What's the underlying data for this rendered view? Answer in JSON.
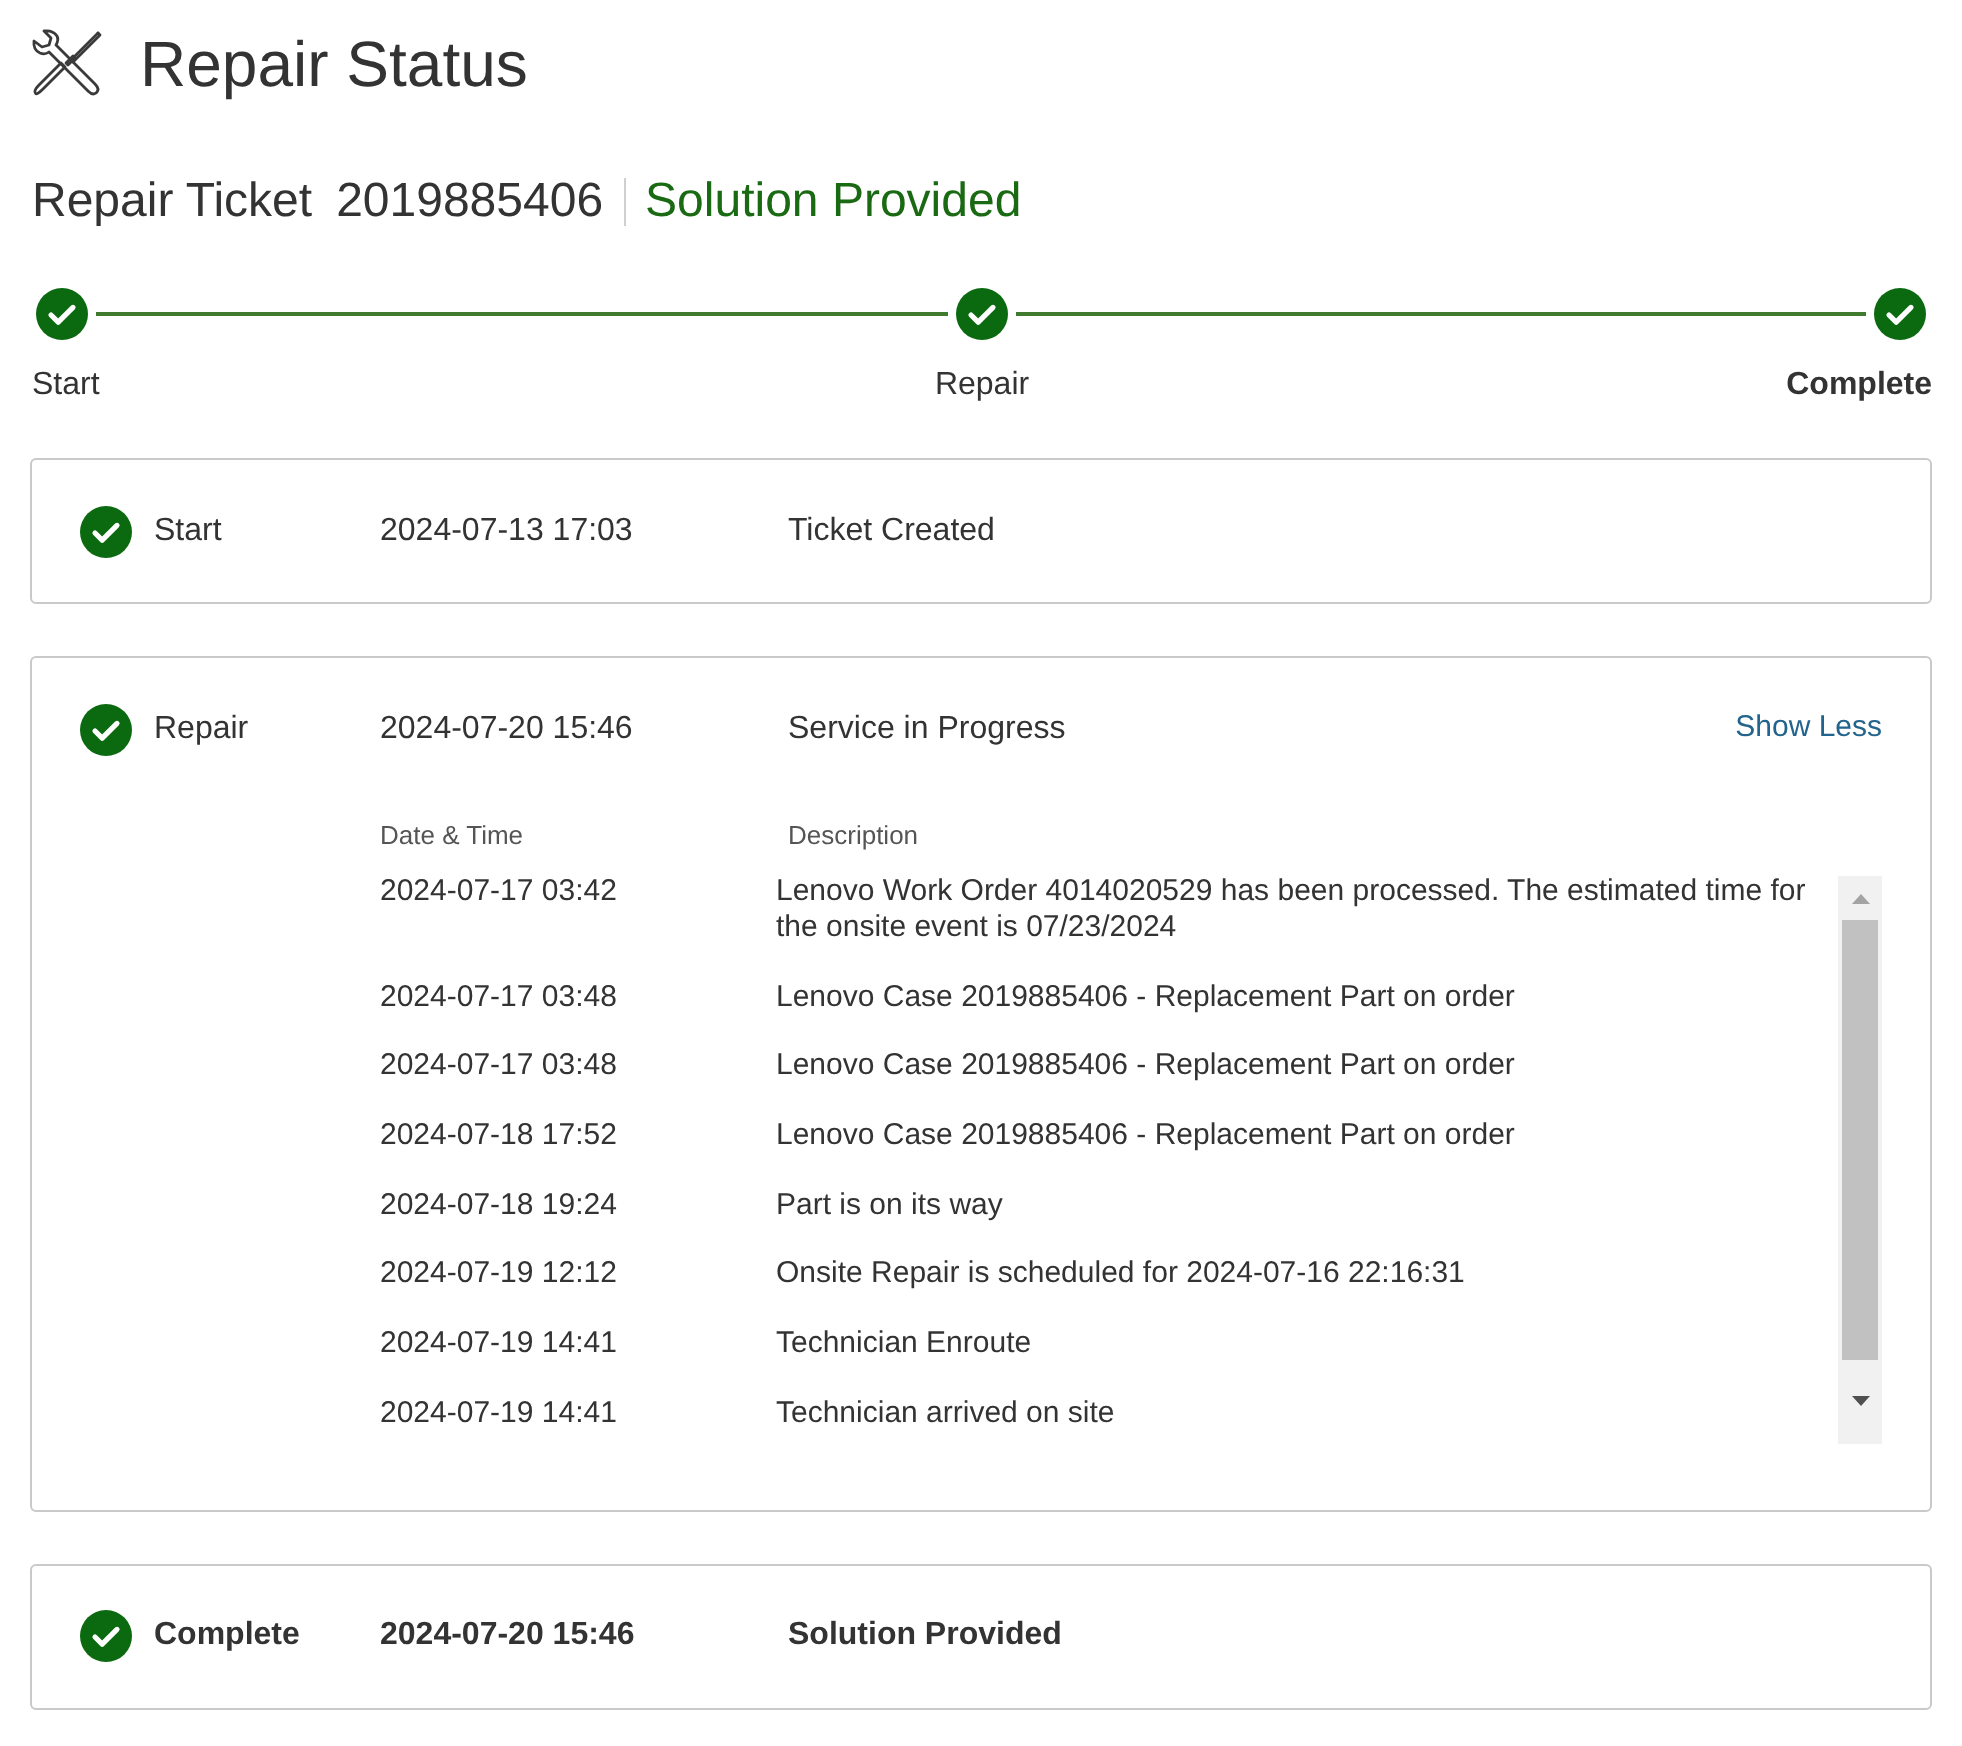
{
  "page": {
    "title": "Repair Status"
  },
  "ticket": {
    "label": "Repair Ticket",
    "number": "2019885406",
    "status": "Solution Provided"
  },
  "stepper": [
    {
      "label": "Start",
      "done": true,
      "current": false
    },
    {
      "label": "Repair",
      "done": true,
      "current": false
    },
    {
      "label": "Complete",
      "done": true,
      "current": true
    }
  ],
  "stages": [
    {
      "name": "Start",
      "datetime": "2024-07-13 17:03",
      "summary": "Ticket Created",
      "done": true,
      "current": false
    },
    {
      "name": "Repair",
      "datetime": "2024-07-20 15:46",
      "summary": "Service in Progress",
      "done": true,
      "current": false,
      "toggle": "Show Less",
      "details": {
        "columns": [
          "Date & Time",
          "Description"
        ],
        "rows": [
          {
            "datetime": "2024-07-17 03:42",
            "description": "Lenovo Work Order 4014020529 has been processed. The estimated time for the onsite event is 07/23/2024"
          },
          {
            "datetime": "2024-07-17 03:48",
            "description": "Lenovo Case 2019885406 - Replacement Part on order"
          },
          {
            "datetime": "2024-07-17 03:48",
            "description": "Lenovo Case 2019885406 - Replacement Part on order"
          },
          {
            "datetime": "2024-07-18 17:52",
            "description": "Lenovo Case 2019885406 - Replacement Part on order"
          },
          {
            "datetime": "2024-07-18 19:24",
            "description": "Part is on its way"
          },
          {
            "datetime": "2024-07-19 12:12",
            "description": "Onsite Repair is scheduled for 2024-07-16 22:16:31"
          },
          {
            "datetime": "2024-07-19 14:41",
            "description": "Technician Enroute"
          },
          {
            "datetime": "2024-07-19 14:41",
            "description": "Technician arrived on site"
          }
        ]
      }
    },
    {
      "name": "Complete",
      "datetime": "2024-07-20 15:46",
      "summary": "Solution Provided",
      "done": true,
      "current": true
    }
  ]
}
